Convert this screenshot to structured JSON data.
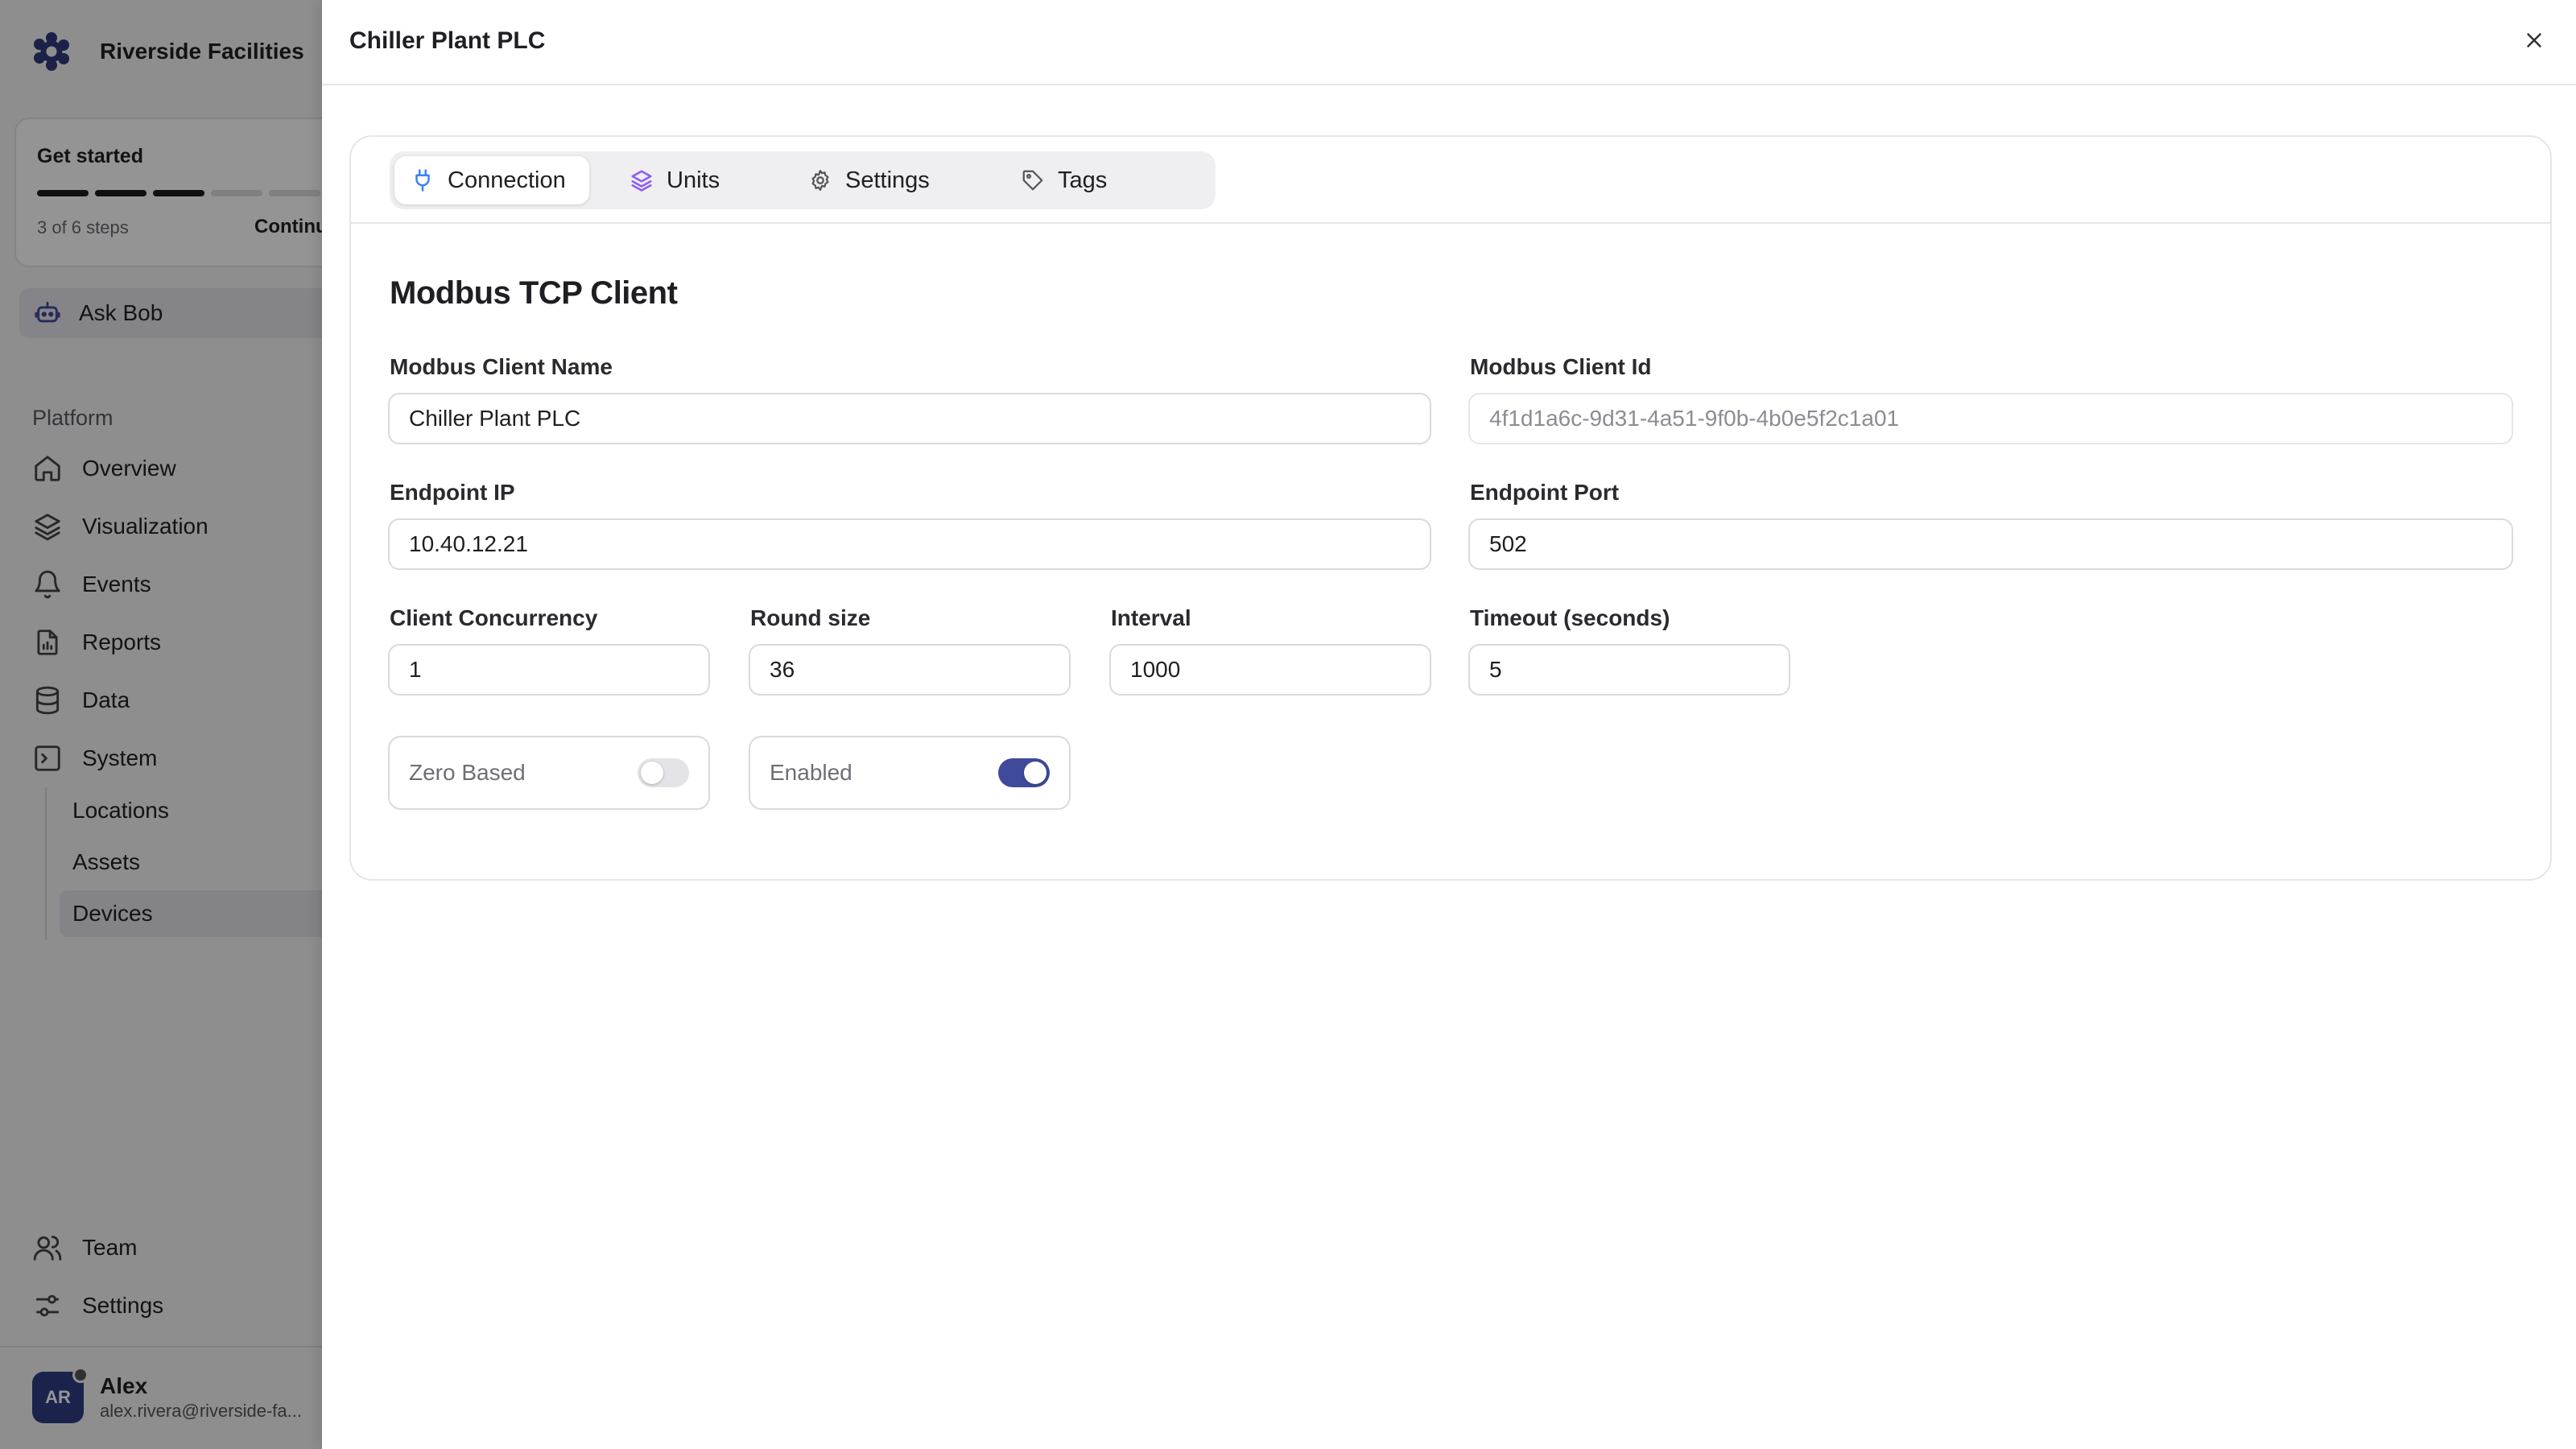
{
  "sidebar": {
    "org_name": "Riverside Facilities",
    "get_started": {
      "title": "Get started",
      "steps_text": "3 of 6 steps",
      "continue_label": "Continue",
      "completed": 3,
      "total": 6
    },
    "ask_bob": "Ask Bob",
    "section_label": "Platform",
    "items": [
      {
        "label": "Overview",
        "icon": "home-icon"
      },
      {
        "label": "Visualization",
        "icon": "layers-icon"
      },
      {
        "label": "Events",
        "icon": "bell-icon"
      },
      {
        "label": "Reports",
        "icon": "report-icon"
      },
      {
        "label": "Data",
        "icon": "database-icon"
      },
      {
        "label": "System",
        "icon": "terminal-icon"
      }
    ],
    "system_children": [
      "Locations",
      "Assets",
      "Devices"
    ],
    "active_child": "Devices",
    "bottom_items": [
      {
        "label": "Team",
        "icon": "users-icon"
      },
      {
        "label": "Settings",
        "icon": "sliders-icon"
      }
    ],
    "user": {
      "initials": "AR",
      "name": "Alex",
      "email": "alex.rivera@riverside-fa..."
    }
  },
  "drawer": {
    "title": "Chiller Plant PLC",
    "tabs": [
      {
        "label": "Connection",
        "icon": "plug-icon",
        "active": true
      },
      {
        "label": "Units",
        "icon": "layers-icon",
        "active": false
      },
      {
        "label": "Settings",
        "icon": "gear-icon",
        "active": false
      },
      {
        "label": "Tags",
        "icon": "tag-icon",
        "active": false
      }
    ],
    "form": {
      "title": "Modbus TCP Client",
      "client_name_label": "Modbus Client Name",
      "client_name_value": "Chiller Plant PLC",
      "client_id_label": "Modbus Client Id",
      "client_id_value": "4f1d1a6c-9d31-4a51-9f0b-4b0e5f2c1a01",
      "endpoint_ip_label": "Endpoint IP",
      "endpoint_ip_value": "10.40.12.21",
      "endpoint_port_label": "Endpoint Port",
      "endpoint_port_value": "502",
      "concurrency_label": "Client Concurrency",
      "concurrency_value": "1",
      "round_size_label": "Round size",
      "round_size_value": "36",
      "interval_label": "Interval",
      "interval_value": "1000",
      "timeout_label": "Timeout (seconds)",
      "timeout_value": "5",
      "zero_based_label": "Zero Based",
      "zero_based_on": false,
      "enabled_label": "Enabled",
      "enabled_on": true
    }
  },
  "colors": {
    "accent": "#3f4a9a",
    "plug_icon": "#3b82f6",
    "units_icon": "#8b5cf6",
    "avatar": "#2f3d86"
  }
}
